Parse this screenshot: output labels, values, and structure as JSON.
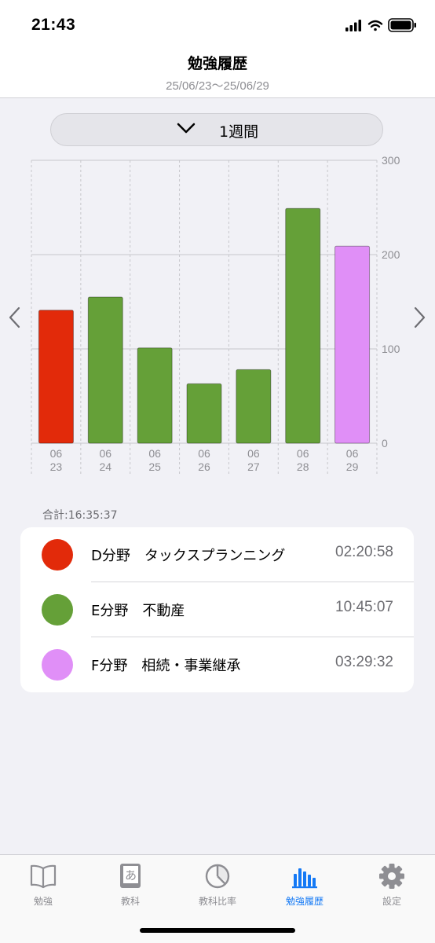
{
  "status": {
    "time": "21:43"
  },
  "header": {
    "title": "勉強履歴",
    "range": "25/06/23〜25/06/29"
  },
  "period": {
    "label": "1週間"
  },
  "chart_data": {
    "type": "bar",
    "categories": [
      "06\n23",
      "06\n24",
      "06\n25",
      "06\n26",
      "06\n27",
      "06\n28",
      "06\n29"
    ],
    "category_month": [
      "06",
      "06",
      "06",
      "06",
      "06",
      "06",
      "06"
    ],
    "category_day": [
      "23",
      "24",
      "25",
      "26",
      "27",
      "28",
      "29"
    ],
    "values": [
      141,
      155,
      101,
      63,
      78,
      249,
      209
    ],
    "colors": [
      "#e22a0a",
      "#65a038",
      "#65a038",
      "#65a038",
      "#65a038",
      "#65a038",
      "#e08ff7"
    ],
    "ylim": [
      0,
      300
    ],
    "yticks": [
      0,
      100,
      200,
      300
    ],
    "ytick_labels": [
      "0",
      "100",
      "200",
      "300"
    ],
    "grid": true
  },
  "summary": {
    "total": "合計:16:35:37",
    "items": [
      {
        "label": "D分野　タックスプランニング",
        "time": "02:20:58",
        "color": "#e22a0a"
      },
      {
        "label": "E分野　不動産",
        "time": "10:45:07",
        "color": "#65a038"
      },
      {
        "label": "F分野　相続・事業継承",
        "time": "03:29:32",
        "color": "#e08ff7"
      }
    ]
  },
  "tabbar": {
    "tabs": [
      {
        "label": "勉強",
        "icon": "book-icon"
      },
      {
        "label": "教科",
        "icon": "textbook-icon"
      },
      {
        "label": "教科比率",
        "icon": "pie-chart-icon"
      },
      {
        "label": "勉強履歴",
        "icon": "bar-chart-icon"
      },
      {
        "label": "設定",
        "icon": "gear-icon"
      }
    ],
    "active_color": "#1479f5",
    "inactive_color": "#8e8e93"
  }
}
